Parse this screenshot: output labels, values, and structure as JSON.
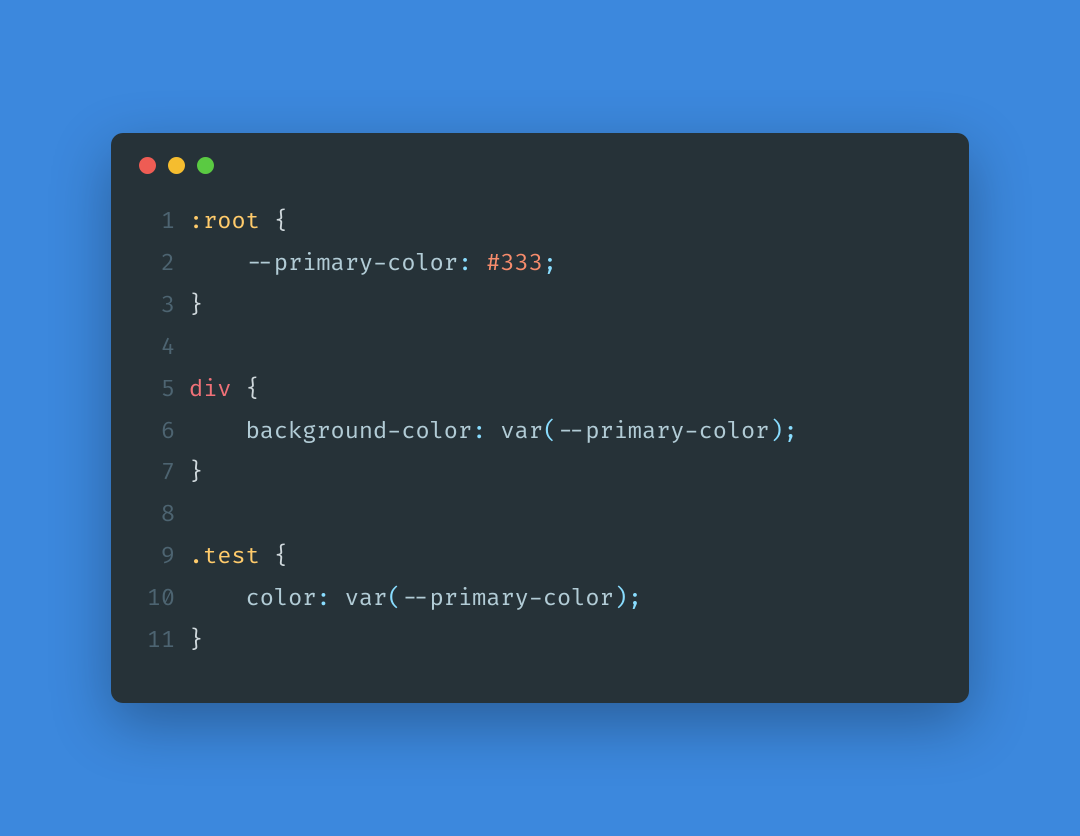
{
  "window": {
    "traffic_lights": [
      "red",
      "yellow",
      "green"
    ]
  },
  "code": {
    "line_numbers": [
      "1",
      "2",
      "3",
      "4",
      "5",
      "6",
      "7",
      "8",
      "9",
      "10",
      "11"
    ],
    "lines": [
      {
        "n": "1",
        "tokens": [
          {
            "t": ":root",
            "c": "cls"
          },
          {
            "t": " ",
            "c": "default"
          },
          {
            "t": "{",
            "c": "brace"
          }
        ]
      },
      {
        "n": "2",
        "tokens": [
          {
            "t": "    ",
            "c": "default"
          },
          {
            "t": "--primary-color",
            "c": "prop"
          },
          {
            "t": ":",
            "c": "punct"
          },
          {
            "t": " ",
            "c": "default"
          },
          {
            "t": "#333",
            "c": "num"
          },
          {
            "t": ";",
            "c": "punct"
          }
        ]
      },
      {
        "n": "3",
        "tokens": [
          {
            "t": "}",
            "c": "brace"
          }
        ]
      },
      {
        "n": "4",
        "tokens": [
          {
            "t": "",
            "c": "default"
          }
        ]
      },
      {
        "n": "5",
        "tokens": [
          {
            "t": "div",
            "c": "tag"
          },
          {
            "t": " ",
            "c": "default"
          },
          {
            "t": "{",
            "c": "brace"
          }
        ]
      },
      {
        "n": "6",
        "tokens": [
          {
            "t": "    ",
            "c": "default"
          },
          {
            "t": "background-color",
            "c": "prop"
          },
          {
            "t": ":",
            "c": "punct"
          },
          {
            "t": " ",
            "c": "default"
          },
          {
            "t": "var",
            "c": "prop"
          },
          {
            "t": "(",
            "c": "punct"
          },
          {
            "t": "--primary-color",
            "c": "prop"
          },
          {
            "t": ")",
            "c": "punct"
          },
          {
            "t": ";",
            "c": "punct"
          }
        ]
      },
      {
        "n": "7",
        "tokens": [
          {
            "t": "}",
            "c": "brace"
          }
        ]
      },
      {
        "n": "8",
        "tokens": [
          {
            "t": "",
            "c": "default"
          }
        ]
      },
      {
        "n": "9",
        "tokens": [
          {
            "t": ".test",
            "c": "cls"
          },
          {
            "t": " ",
            "c": "default"
          },
          {
            "t": "{",
            "c": "brace"
          }
        ]
      },
      {
        "n": "10",
        "tokens": [
          {
            "t": "    ",
            "c": "default"
          },
          {
            "t": "color",
            "c": "prop"
          },
          {
            "t": ":",
            "c": "punct"
          },
          {
            "t": " ",
            "c": "default"
          },
          {
            "t": "var",
            "c": "prop"
          },
          {
            "t": "(",
            "c": "punct"
          },
          {
            "t": "--primary-color",
            "c": "prop"
          },
          {
            "t": ")",
            "c": "punct"
          },
          {
            "t": ";",
            "c": "punct"
          }
        ]
      },
      {
        "n": "11",
        "tokens": [
          {
            "t": "}",
            "c": "brace"
          }
        ]
      }
    ]
  }
}
